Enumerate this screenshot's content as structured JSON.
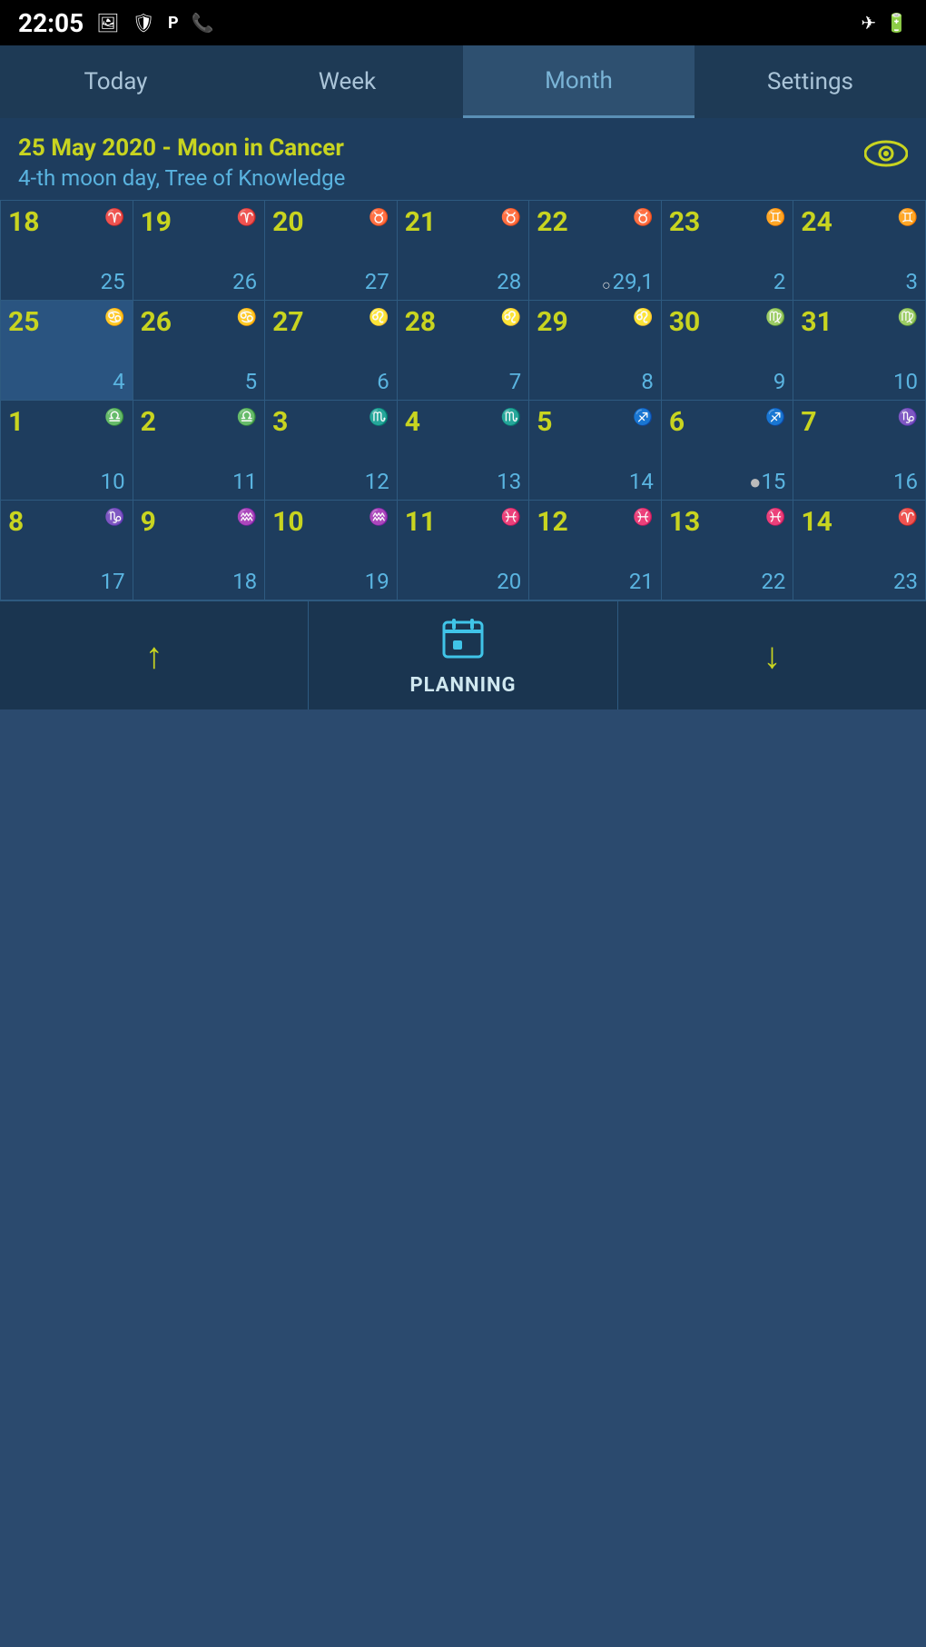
{
  "statusBar": {
    "time": "22:05",
    "icons": [
      "🖼",
      "🛡",
      "P",
      "📞"
    ],
    "rightIcons": [
      "✈",
      "🔋"
    ]
  },
  "tabs": [
    {
      "id": "today",
      "label": "Today"
    },
    {
      "id": "week",
      "label": "Week"
    },
    {
      "id": "month",
      "label": "Month",
      "active": true
    },
    {
      "id": "settings",
      "label": "Settings"
    }
  ],
  "header": {
    "date": "25 May 2020 - Moon in Cancer",
    "moonDay": "4-th moon day, Tree of Knowledge"
  },
  "calendar": {
    "rows": [
      [
        {
          "day": 18,
          "moonDay": 25,
          "zodiac": "♈",
          "phase": ""
        },
        {
          "day": 19,
          "moonDay": 26,
          "zodiac": "♈",
          "phase": ""
        },
        {
          "day": 20,
          "moonDay": 27,
          "zodiac": "♉",
          "phase": ""
        },
        {
          "day": 21,
          "moonDay": 28,
          "zodiac": "♉",
          "phase": ""
        },
        {
          "day": 22,
          "moonDay": "29,1",
          "zodiac": "♉",
          "phase": "○"
        },
        {
          "day": 23,
          "moonDay": 2,
          "zodiac": "♊",
          "phase": ""
        },
        {
          "day": 24,
          "moonDay": 3,
          "zodiac": "♊",
          "phase": ""
        }
      ],
      [
        {
          "day": 25,
          "moonDay": 4,
          "zodiac": "♋",
          "phase": "",
          "selected": true
        },
        {
          "day": 26,
          "moonDay": 5,
          "zodiac": "♋",
          "phase": ""
        },
        {
          "day": 27,
          "moonDay": 6,
          "zodiac": "♌",
          "phase": ""
        },
        {
          "day": 28,
          "moonDay": 7,
          "zodiac": "♌",
          "phase": ""
        },
        {
          "day": 29,
          "moonDay": 8,
          "zodiac": "♌",
          "phase": ""
        },
        {
          "day": 30,
          "moonDay": 9,
          "zodiac": "♍",
          "phase": ""
        },
        {
          "day": 31,
          "moonDay": 10,
          "zodiac": "♍",
          "phase": ""
        }
      ],
      [
        {
          "day": 1,
          "moonDay": 10,
          "zodiac": "♎",
          "phase": ""
        },
        {
          "day": 2,
          "moonDay": 11,
          "zodiac": "♎",
          "phase": ""
        },
        {
          "day": 3,
          "moonDay": 12,
          "zodiac": "♏",
          "phase": ""
        },
        {
          "day": 4,
          "moonDay": 13,
          "zodiac": "♏",
          "phase": ""
        },
        {
          "day": 5,
          "moonDay": 14,
          "zodiac": "♐",
          "phase": ""
        },
        {
          "day": 6,
          "moonDay": 15,
          "zodiac": "♐",
          "phase": "●"
        },
        {
          "day": 7,
          "moonDay": 16,
          "zodiac": "♑",
          "phase": ""
        }
      ],
      [
        {
          "day": 8,
          "moonDay": 17,
          "zodiac": "♑",
          "phase": ""
        },
        {
          "day": 9,
          "moonDay": 18,
          "zodiac": "♒",
          "phase": ""
        },
        {
          "day": 10,
          "moonDay": 19,
          "zodiac": "♒",
          "phase": ""
        },
        {
          "day": 11,
          "moonDay": 20,
          "zodiac": "♓",
          "phase": ""
        },
        {
          "day": 12,
          "moonDay": 21,
          "zodiac": "♓",
          "phase": ""
        },
        {
          "day": 13,
          "moonDay": 22,
          "zodiac": "♓",
          "phase": ""
        },
        {
          "day": 14,
          "moonDay": 23,
          "zodiac": "♈",
          "phase": ""
        }
      ]
    ]
  },
  "bottomBar": {
    "prevLabel": "↑",
    "nextLabel": "↓",
    "planningLabel": "PLANNING",
    "planningIcon": "📅"
  }
}
